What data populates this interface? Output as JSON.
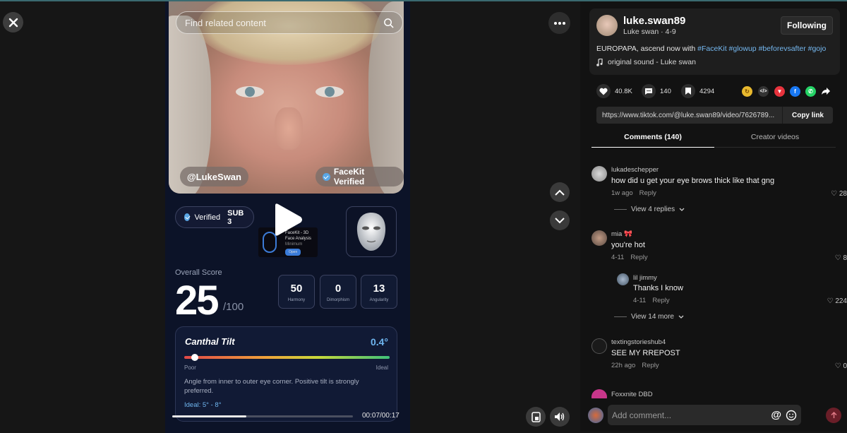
{
  "video": {
    "search_placeholder": "Find related content",
    "tag_user": "@LukeSwan",
    "tag_verified": "FaceKit Verified",
    "verified_label": "Verified",
    "sub_label": "SUB 3",
    "ad": {
      "title": "FaceKit - 3D Face Analysis",
      "sub": "Minimum",
      "open": "Open"
    },
    "overall_label": "Overall Score",
    "score": "25",
    "out_of": "/100",
    "metrics": [
      {
        "value": "50",
        "name": "Harmony"
      },
      {
        "value": "0",
        "name": "Dimorphism"
      },
      {
        "value": "13",
        "name": "Angularity"
      }
    ],
    "canthal": {
      "title": "Canthal Tilt",
      "value": "0.4°",
      "poor": "Poor",
      "ideal": "Ideal",
      "desc": "Angle from inner to outer eye corner. Positive tilt is strongly preferred.",
      "ideal_range": "Ideal: 5° - 8°",
      "level": 0.05
    },
    "time": "00:07/00:17",
    "progress": 0.41
  },
  "post": {
    "username": "luke.swan89",
    "display": "Luke swan · 4-9",
    "follow": "Following",
    "caption_text": "EUROPAPA, ascend now with ",
    "hashtags": [
      "#FaceKit",
      "#glowup",
      "#beforevsafter",
      "#gojo"
    ],
    "sound": "original sound - Luke swan",
    "likes": "40.8K",
    "comments": "140",
    "saves": "4294",
    "url": "https://www.tiktok.com/@luke.swan89/video/7626789...",
    "copy": "Copy link"
  },
  "tabs": {
    "comments": "Comments (140)",
    "creator": "Creator videos"
  },
  "comments": [
    {
      "user": "lukadeschepper",
      "text": "how did u get your eye brows thick like that gng",
      "time": "1w ago",
      "reply": "Reply",
      "likes": "28",
      "more": "View 4 replies"
    },
    {
      "user": "mia 🎀",
      "text": "you're hot",
      "time": "4-11",
      "reply": "Reply",
      "likes": "8"
    },
    {
      "user": "lil jimmy",
      "text": "Thanks I know",
      "time": "4-11",
      "reply": "Reply",
      "likes": "224",
      "more": "View 14 more"
    },
    {
      "user": "textingstorieshub4",
      "text": "SEE MY RREPOST",
      "time": "22h ago",
      "reply": "Reply",
      "likes": "0"
    },
    {
      "user": "Foxxnite DBD"
    }
  ],
  "composer": {
    "placeholder": "Add comment...",
    "at": "@"
  }
}
